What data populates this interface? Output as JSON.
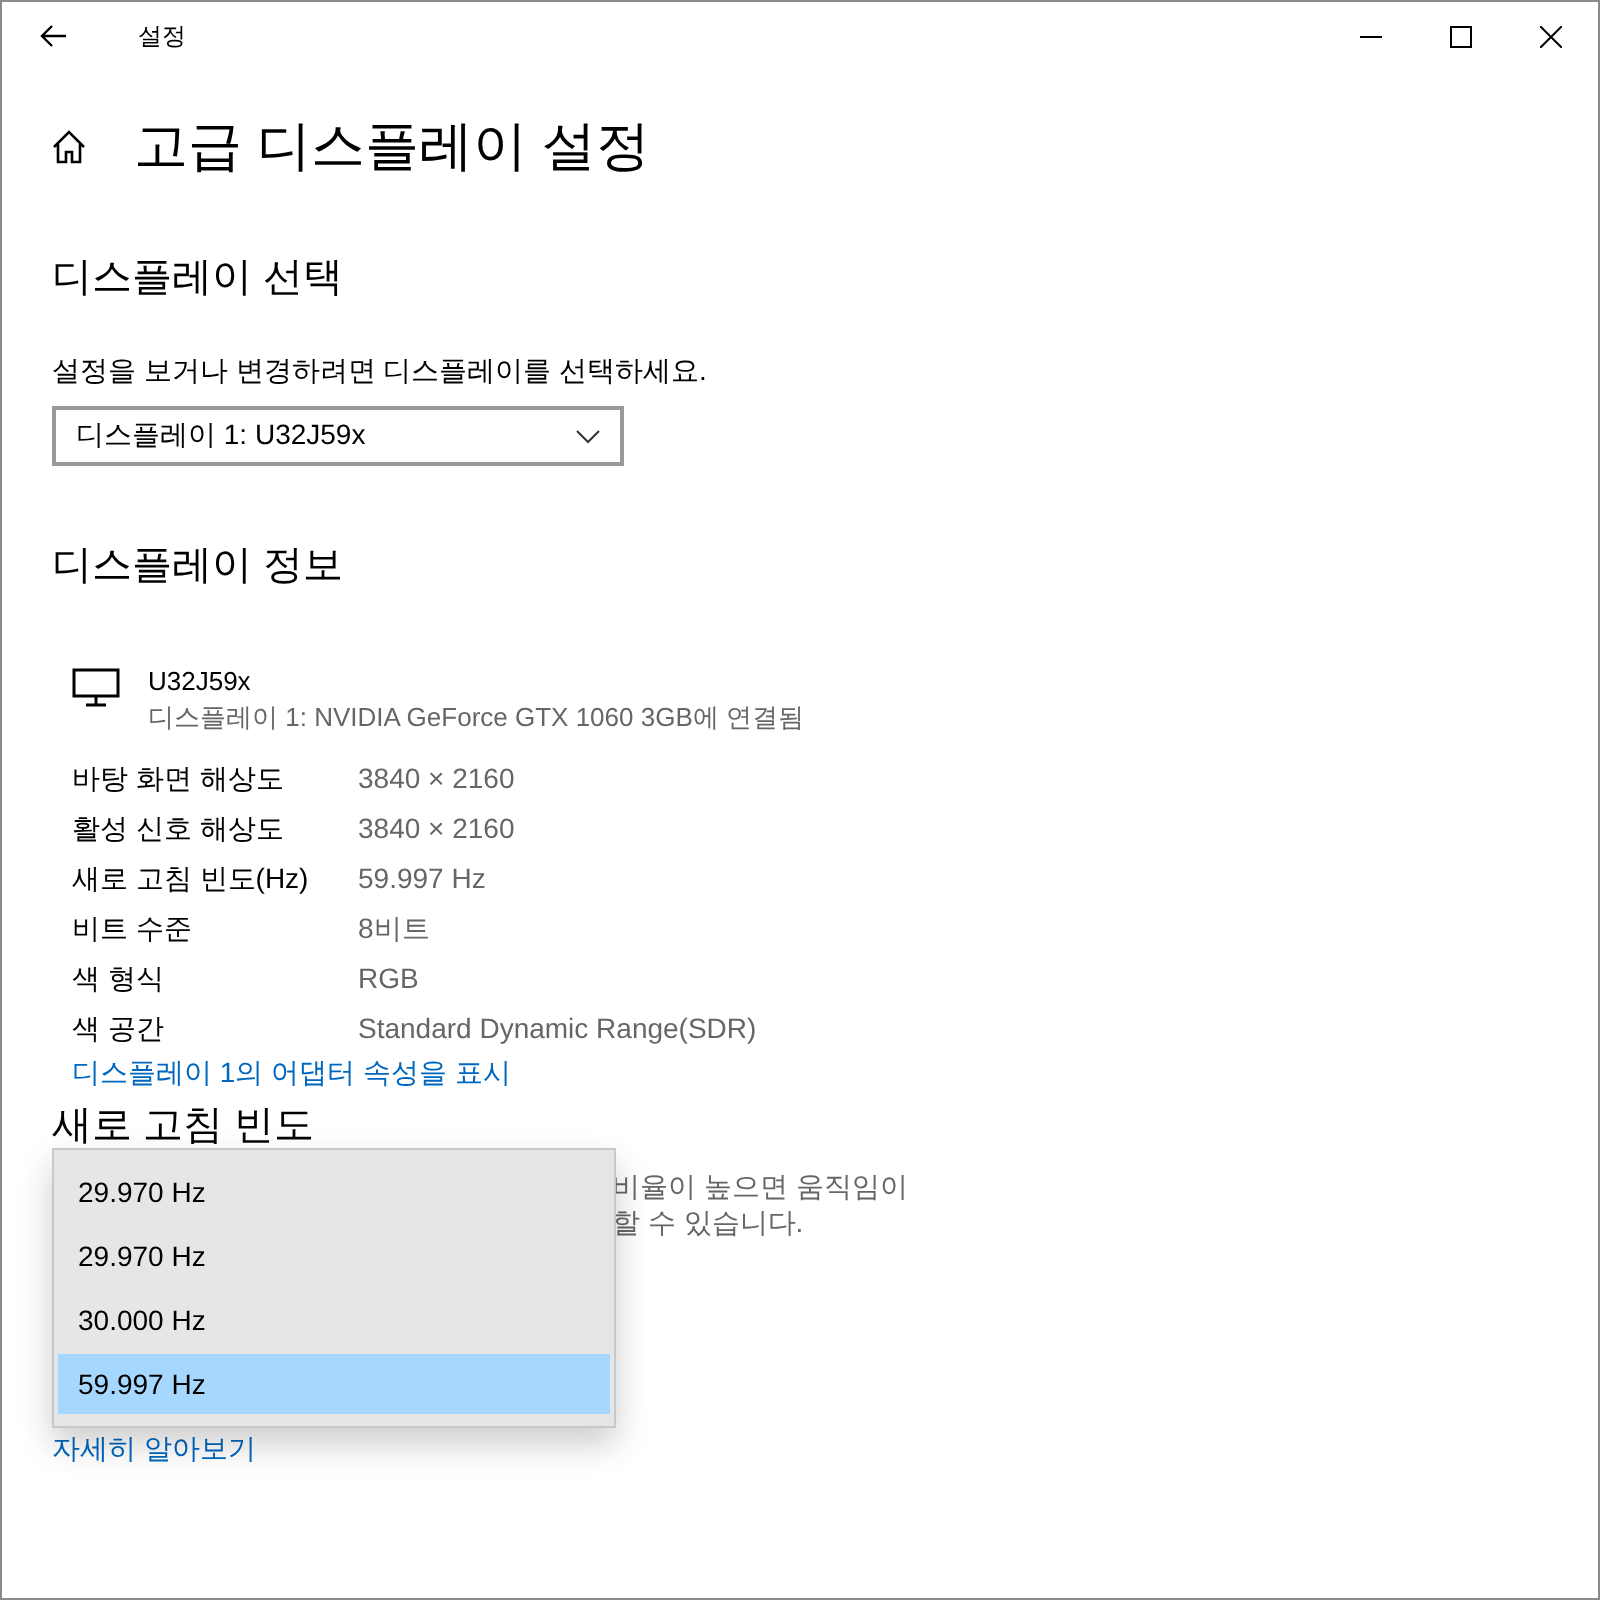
{
  "window": {
    "title": "설정"
  },
  "page_title": "고급 디스플레이 설정",
  "display_select": {
    "heading": "디스플레이 선택",
    "description": "설정을 보거나 변경하려면 디스플레이를 선택하세요.",
    "value": "디스플레이 1: U32J59x"
  },
  "display_info": {
    "heading": "디스플레이 정보",
    "monitor_name": "U32J59x",
    "monitor_detail": "디스플레이 1: NVIDIA GeForce GTX 1060 3GB에 연결됨",
    "rows": [
      {
        "label": "바탕 화면 해상도",
        "value": "3840 × 2160"
      },
      {
        "label": "활성 신호 해상도",
        "value": "3840 × 2160"
      },
      {
        "label": "새로 고침 빈도(Hz)",
        "value": "59.997 Hz"
      },
      {
        "label": "비트 수준",
        "value": "8비트"
      },
      {
        "label": "색 형식",
        "value": "RGB"
      },
      {
        "label": "색 공간",
        "value": "Standard Dynamic Range(SDR)"
      }
    ],
    "link": "디스플레이 1의 어댑터 속성을 표시"
  },
  "refresh_rate": {
    "heading": "새로 고침 빈도",
    "description_lines": [
      "비율이 높으면 움직임이",
      "할 수 있습니다."
    ],
    "options": [
      {
        "label": "29.970 Hz",
        "selected": false
      },
      {
        "label": "29.970 Hz",
        "selected": false
      },
      {
        "label": "30.000 Hz",
        "selected": false
      },
      {
        "label": "59.997 Hz",
        "selected": true
      }
    ],
    "link": "자세히 알아보기"
  }
}
